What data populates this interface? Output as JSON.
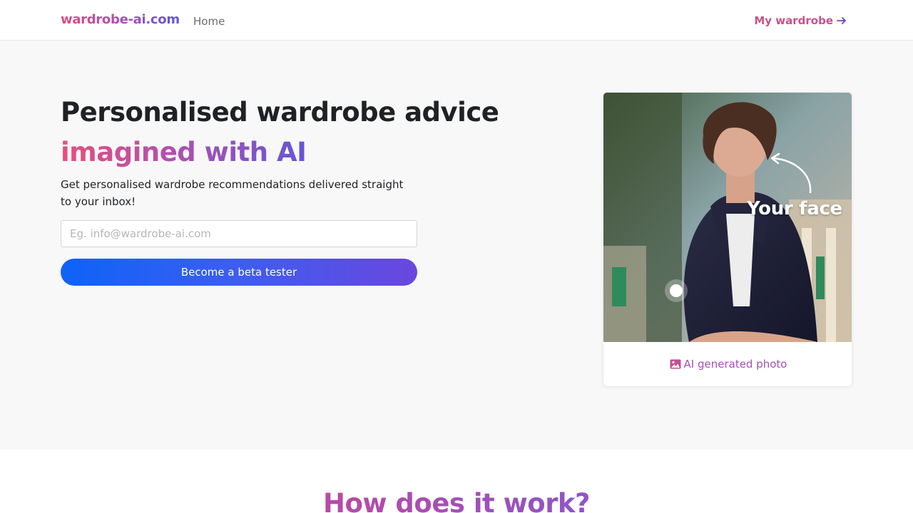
{
  "nav": {
    "brand": "wardrobe-ai.com",
    "home": "Home",
    "my_wardrobe": "My wardrobe",
    "arrow_icon": "arrow-right-icon"
  },
  "hero": {
    "title": "Personalised wardrobe advice",
    "accent": "imagined with AI",
    "description": "Get personalised wardrobe recommendations delivered straight to your inbox!",
    "email_placeholder": "Eg. info@wardrobe-ai.com",
    "email_value": "",
    "cta": "Become a beta tester"
  },
  "photo_card": {
    "overlay_label": "Your face",
    "caption": "AI generated photo",
    "caption_icon": "image-icon"
  },
  "section": {
    "title": "How does it work?"
  },
  "colors": {
    "brand_pink": "#e84f7a",
    "brand_purple": "#a34fb3",
    "brand_blue": "#0d63f8",
    "background": "#f8f8f8"
  }
}
